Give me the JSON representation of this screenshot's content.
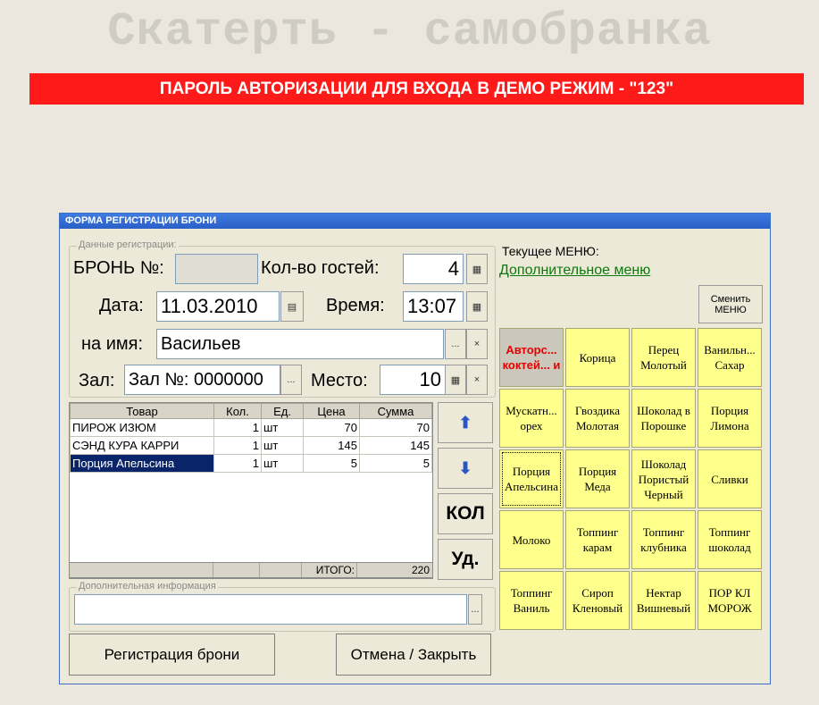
{
  "app": {
    "title": "Скатерть - самобранка"
  },
  "banner": {
    "text": "ПАРОЛЬ АВТОРИЗАЦИИ ДЛЯ ВХОДА В ДЕМО РЕЖИМ - \"123\""
  },
  "dialog": {
    "title": "ФОРМА РЕГИСТРАЦИИ БРОНИ",
    "reg_group": "Данные регистрации:",
    "booking_label": "БРОНЬ №:",
    "booking_value": "",
    "guests_label": "Кол-во гостей:",
    "guests_value": "4",
    "date_label": "Дата:",
    "date_value": "11.03.2010",
    "time_label": "Время:",
    "time_value": "13:07",
    "name_label": "на имя:",
    "name_value": "Васильев",
    "hall_label": "Зал:",
    "hall_value": "Зал №: 0000000",
    "place_label": "Место:",
    "place_value": "10",
    "ellipsis": "...",
    "clear": "×",
    "calc": "▦",
    "calendar": "▤"
  },
  "table": {
    "headers": [
      "Товар",
      "Кол.",
      "Ед.",
      "Цена",
      "Сумма"
    ],
    "rows": [
      {
        "name": "ПИРОЖ ИЗЮМ",
        "qty": "1",
        "unit": "шт",
        "price": "70",
        "sum": "70"
      },
      {
        "name": "СЭНД КУРА КАРРИ",
        "qty": "1",
        "unit": "шт",
        "price": "145",
        "sum": "145"
      },
      {
        "name": "Порция Апельсина",
        "qty": "1",
        "unit": "шт",
        "price": "5",
        "sum": "5"
      }
    ],
    "total_label": "ИТОГО:",
    "total_value": "220"
  },
  "side_buttons": {
    "up": "⬆",
    "down": "⬇",
    "qty": "КОЛ",
    "delete": "Уд."
  },
  "extra": {
    "group": "Дополнительная информация",
    "value": ""
  },
  "actions": {
    "register": "Регистрация брони",
    "cancel": "Отмена / Закрыть"
  },
  "menu": {
    "current_label": "Текущее МЕНЮ:",
    "current_name": "Дополнительное меню",
    "change_button": "Сменить МЕНЮ",
    "items": [
      "Авторс... коктей... и",
      "Корица",
      "Перец Молотый",
      "Ванильн... Сахар",
      "Мускатн... орех",
      "Гвоздика Молотая",
      "Шоколад в Порошке",
      "Порция Лимона",
      "Порция Апельсина",
      "Порция Меда",
      "Шоколад Пористый Черный",
      "Сливки",
      "Молоко",
      "Топпинг карам",
      "Топпинг клубника",
      "Топпинг шоколад",
      "Топпинг Ваниль",
      "Сироп Кленовый",
      "Нектар Вишневый",
      "ПОР КЛ МОРОЖ"
    ]
  },
  "colors": {
    "banner": "#ff1a1a",
    "tile": "#ffff8c",
    "titlebar": "#2a5fc7",
    "link": "#0a7a0a"
  }
}
